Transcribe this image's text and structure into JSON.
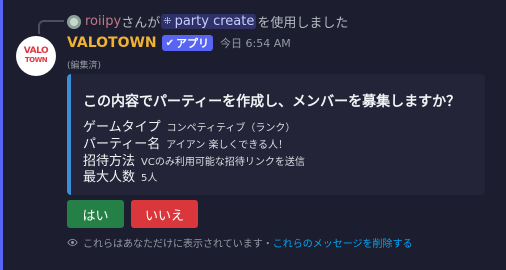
{
  "reply": {
    "username": "roiipy",
    "prefix": "さんが",
    "command_name": "party create",
    "suffix": "を使用しました"
  },
  "author": {
    "avatar_line1": "VALO",
    "avatar_line2": "TOWN",
    "name": "VALOTOWN",
    "badge_label": "アプリ",
    "timestamp": "今日 6:54 AM",
    "edited": "(編集済)"
  },
  "embed": {
    "accent_color": "#3a8fd6",
    "title": "この内容でパーティーを作成し、メンバーを募集しますか？",
    "fields": [
      {
        "name": "ゲームタイプ",
        "value": "コンペティティブ（ランク）"
      },
      {
        "name": "パーティー名",
        "value": "アイアン 楽しくできる人！"
      },
      {
        "name": "招待方法",
        "value": "VCのみ利用可能な招待リンクを送信"
      },
      {
        "name": "最大人数",
        "value": "5人"
      }
    ]
  },
  "buttons": {
    "yes_label": "はい",
    "no_label": "いいえ"
  },
  "ephemeral": {
    "notice": "これらはあなただけに表示されています・",
    "dismiss_link": "これらのメッセージを削除する"
  },
  "icons": {
    "command": "slash-command-icon",
    "badge": "check-icon",
    "ephemeral": "eye-icon"
  }
}
